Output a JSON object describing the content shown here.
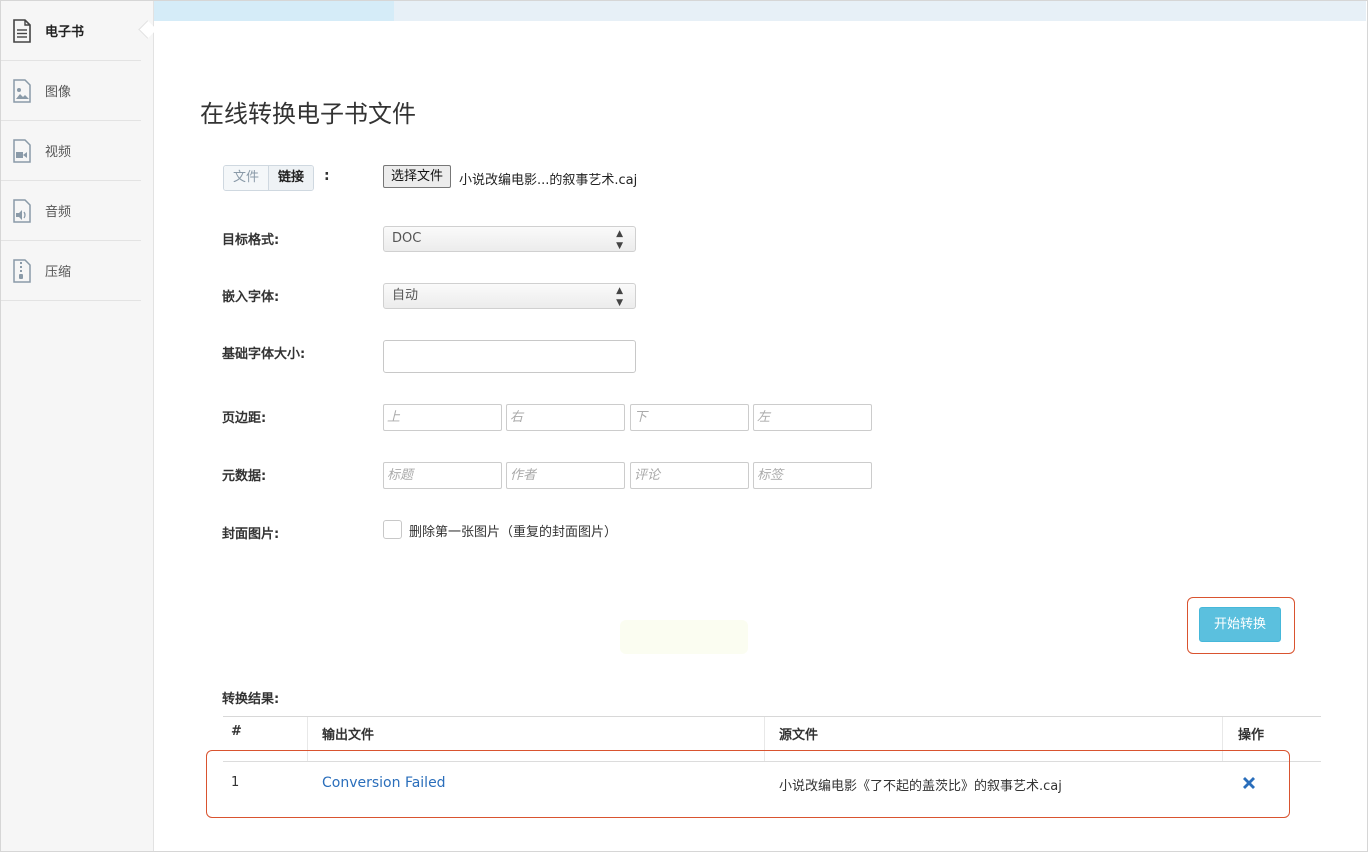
{
  "sidebar": {
    "items": [
      {
        "label": "电子书",
        "icon": "document-icon",
        "active": true
      },
      {
        "label": "图像",
        "icon": "image-icon",
        "active": false
      },
      {
        "label": "视频",
        "icon": "video-icon",
        "active": false
      },
      {
        "label": "音频",
        "icon": "audio-icon",
        "active": false
      },
      {
        "label": "压缩",
        "icon": "archive-icon",
        "active": false
      }
    ]
  },
  "page": {
    "title": "在线转换电子书文件"
  },
  "source": {
    "tab_file": "文件",
    "tab_link": "链接",
    "colon": ":",
    "choose_button": "选择文件",
    "file_name": "小说改编电影...的叙事艺术.caj"
  },
  "form": {
    "target_format": {
      "label": "目标格式:",
      "value": "DOC"
    },
    "embed_font": {
      "label": "嵌入字体:",
      "value": "自动"
    },
    "base_font_size": {
      "label": "基础字体大小:",
      "value": ""
    },
    "margins": {
      "label": "页边距:",
      "placeholders": [
        "上",
        "右",
        "下",
        "左"
      ]
    },
    "metadata": {
      "label": "元数据:",
      "placeholders": [
        "标题",
        "作者",
        "评论",
        "标签"
      ]
    },
    "cover": {
      "label": "封面图片:",
      "checkbox_label": "删除第一张图片（重复的封面图片）",
      "checked": false
    }
  },
  "actions": {
    "start_button": "开始转换"
  },
  "results": {
    "label": "转换结果:",
    "headers": [
      "#",
      "输出文件",
      "源文件",
      "操作"
    ],
    "rows": [
      {
        "index": "1",
        "output": "Conversion Failed",
        "source": "小说改编电影《了不起的盖茨比》的叙事艺术.caj",
        "action_icon": "delete-icon"
      }
    ]
  },
  "colors": {
    "accent": "#5bc0de",
    "link": "#2a6ebb",
    "highlight": "#d9532f",
    "delete": "#2a6ebb"
  }
}
